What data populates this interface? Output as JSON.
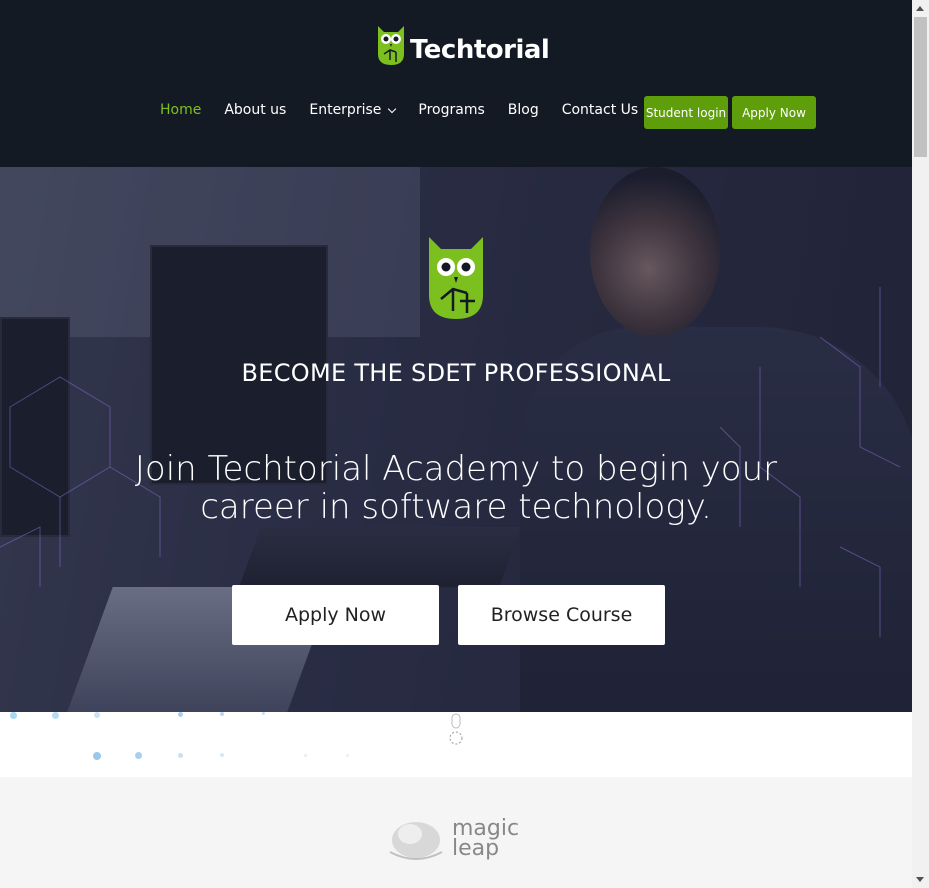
{
  "brand": {
    "name": "Techtorial",
    "logo_icon": "owl-icon",
    "accent": "#7cc020"
  },
  "nav": {
    "items": [
      {
        "label": "Home",
        "active": true
      },
      {
        "label": "About us"
      },
      {
        "label": "Enterprise"
      },
      {
        "label": "Programs"
      },
      {
        "label": "Blog"
      },
      {
        "label": "Contact Us"
      }
    ],
    "student_login": "Student login",
    "apply_now": "Apply Now",
    "button_color": "#5f9e0b"
  },
  "hero": {
    "title": "BECOME THE SDET PROFESSIONAL",
    "subtitle_line1": "Join Techtorial Academy to begin your",
    "subtitle_line2": "career in software technology.",
    "apply_button": "Apply Now",
    "browse_button": "Browse Course"
  },
  "partners": {
    "logo_text_line1": "magic",
    "logo_text_line2": "leap"
  }
}
